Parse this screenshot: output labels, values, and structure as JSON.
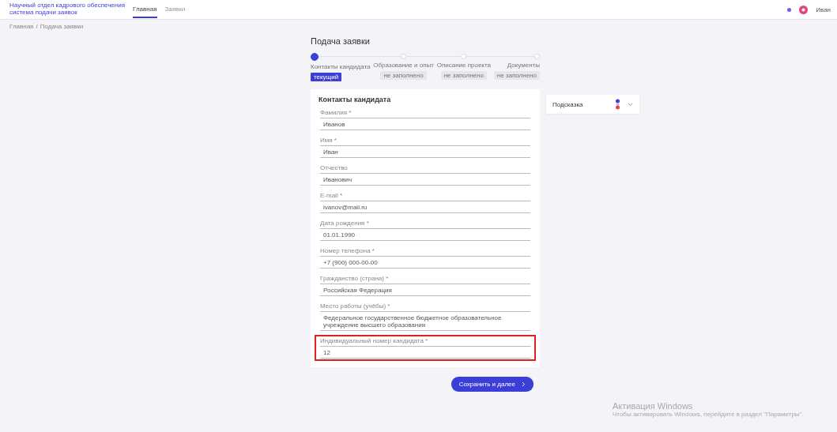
{
  "header": {
    "logo": "Научный отдел кадрового обеспечения",
    "logo_sub": "система подачи заявок",
    "nav": [
      {
        "label": "Главная",
        "selected": true
      },
      {
        "label": "Заявки",
        "selected": false
      }
    ],
    "user": "Иван"
  },
  "breadcrumbs": [
    "Главная",
    "Подача заявки"
  ],
  "breadcrumb_separator": "/",
  "page_title": "Подача заявки",
  "steps": [
    {
      "label": "Контакты кандидата",
      "badge": "текущий",
      "selected": true
    },
    {
      "label": "Образование и опыт",
      "badge": "не заполнено",
      "selected": false
    },
    {
      "label": "Описание проекта",
      "badge": "не заполнено",
      "selected": false
    },
    {
      "label": "Документы",
      "badge": "не заполнено",
      "selected": false
    }
  ],
  "form": {
    "title": "Контакты кандидата",
    "fields": [
      {
        "label": "Фамилия *",
        "value": "Иванов",
        "highlighted": false
      },
      {
        "label": "Имя *",
        "value": "Иван",
        "highlighted": false
      },
      {
        "label": "Отчество",
        "value": "Иванович",
        "highlighted": false
      },
      {
        "label": "E-mail *",
        "value": "ivanov@mail.ru",
        "highlighted": false
      },
      {
        "label": "Дата рождения *",
        "value": "01.01.1990",
        "highlighted": false
      },
      {
        "label": "Номер телефона *",
        "value": "+7 (900) 000-00-00",
        "highlighted": false
      },
      {
        "label": "Гражданство (страна) *",
        "value": "Российская Федерация",
        "highlighted": false
      },
      {
        "label": "Место работы (учёбы) *",
        "value": "Федеральное государственное бюджетное образовательное учреждение высшего образования",
        "highlighted": false
      },
      {
        "label": "Индивидуальный номер кандидата *",
        "value": "12",
        "highlighted": true
      }
    ]
  },
  "help": {
    "title": "Подсказка"
  },
  "submit": "Сохранить и далее",
  "os_notice": {
    "title": "Активация Windows",
    "text": "Чтобы активировать Windows, перейдите в раздел \"Параметры\"."
  }
}
